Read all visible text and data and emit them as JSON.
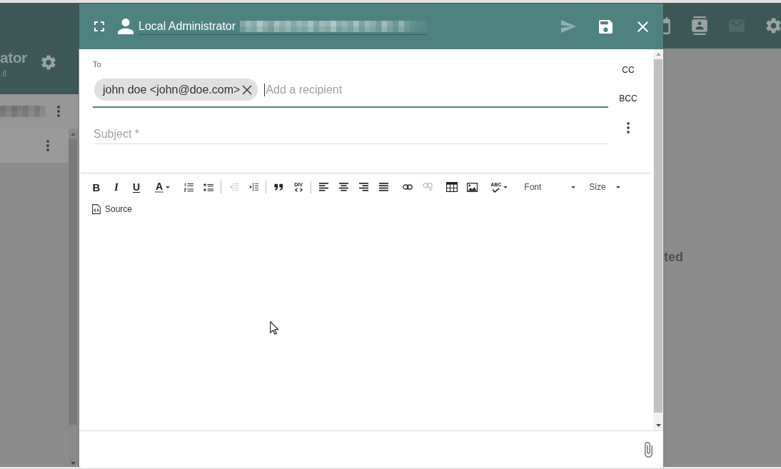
{
  "background_app": {
    "sidebar": {
      "title": "ator",
      "subtitle": ".it",
      "rows": [
        {
          "selected": true
        }
      ]
    },
    "top_bar_icons": [
      {
        "kind": "calendar",
        "selected": false
      },
      {
        "kind": "contacts",
        "selected": false
      },
      {
        "kind": "mail",
        "selected": true
      },
      {
        "kind": "settings",
        "selected": false
      }
    ],
    "main": {
      "message": "ted"
    }
  },
  "compose_dialog": {
    "sender": "Local Administrator",
    "actions": [
      {
        "kind": "send",
        "disabled": true
      },
      {
        "kind": "save",
        "disabled": false
      },
      {
        "kind": "close",
        "disabled": false
      }
    ],
    "to_label": "To",
    "recipients": [
      {
        "label": "john doe <john@doe.com>"
      }
    ],
    "recipient_placeholder": "Add a recipient",
    "recipient_options": [
      {
        "label": "CC"
      },
      {
        "label": "BCC"
      }
    ],
    "subject_placeholder": "Subject *",
    "toolbar": [
      {
        "sections": [
          [
            {
              "kind": "bold",
              "label": "B",
              "disabled": false
            },
            {
              "kind": "italic",
              "label": "I",
              "disabled": false
            },
            {
              "kind": "underline",
              "label": "U",
              "disabled": false
            }
          ]
        ]
      },
      {
        "sections": [
          [
            {
              "kind": "text-color",
              "label": "A",
              "disabled": false
            }
          ]
        ]
      },
      {
        "sections": [
          [
            {
              "kind": "numbered-list",
              "disabled": false
            },
            {
              "kind": "bulleted-list",
              "disabled": false
            }
          ],
          [
            {
              "kind": "outdent",
              "disabled": true
            },
            {
              "kind": "indent",
              "disabled": false
            }
          ],
          [
            {
              "kind": "blockquote",
              "disabled": false
            },
            {
              "kind": "div",
              "label": "DIV",
              "disabled": false
            }
          ],
          [
            {
              "kind": "align-left",
              "disabled": false
            },
            {
              "kind": "align-center",
              "disabled": false
            },
            {
              "kind": "align-right",
              "disabled": false
            },
            {
              "kind": "justify",
              "disabled": false
            }
          ]
        ]
      },
      {
        "sections": [
          [
            {
              "kind": "link",
              "disabled": false
            },
            {
              "kind": "unlink",
              "disabled": true
            }
          ]
        ]
      },
      {
        "sections": [
          [
            {
              "kind": "table",
              "disabled": false
            },
            {
              "kind": "image",
              "disabled": false
            }
          ]
        ]
      },
      {
        "sections": [
          [
            {
              "kind": "spellcheck",
              "label": "ABC",
              "disabled": false
            }
          ]
        ]
      }
    ],
    "combos": [
      {
        "label": "Font"
      },
      {
        "label": "Size"
      }
    ],
    "source_button": "Source"
  }
}
